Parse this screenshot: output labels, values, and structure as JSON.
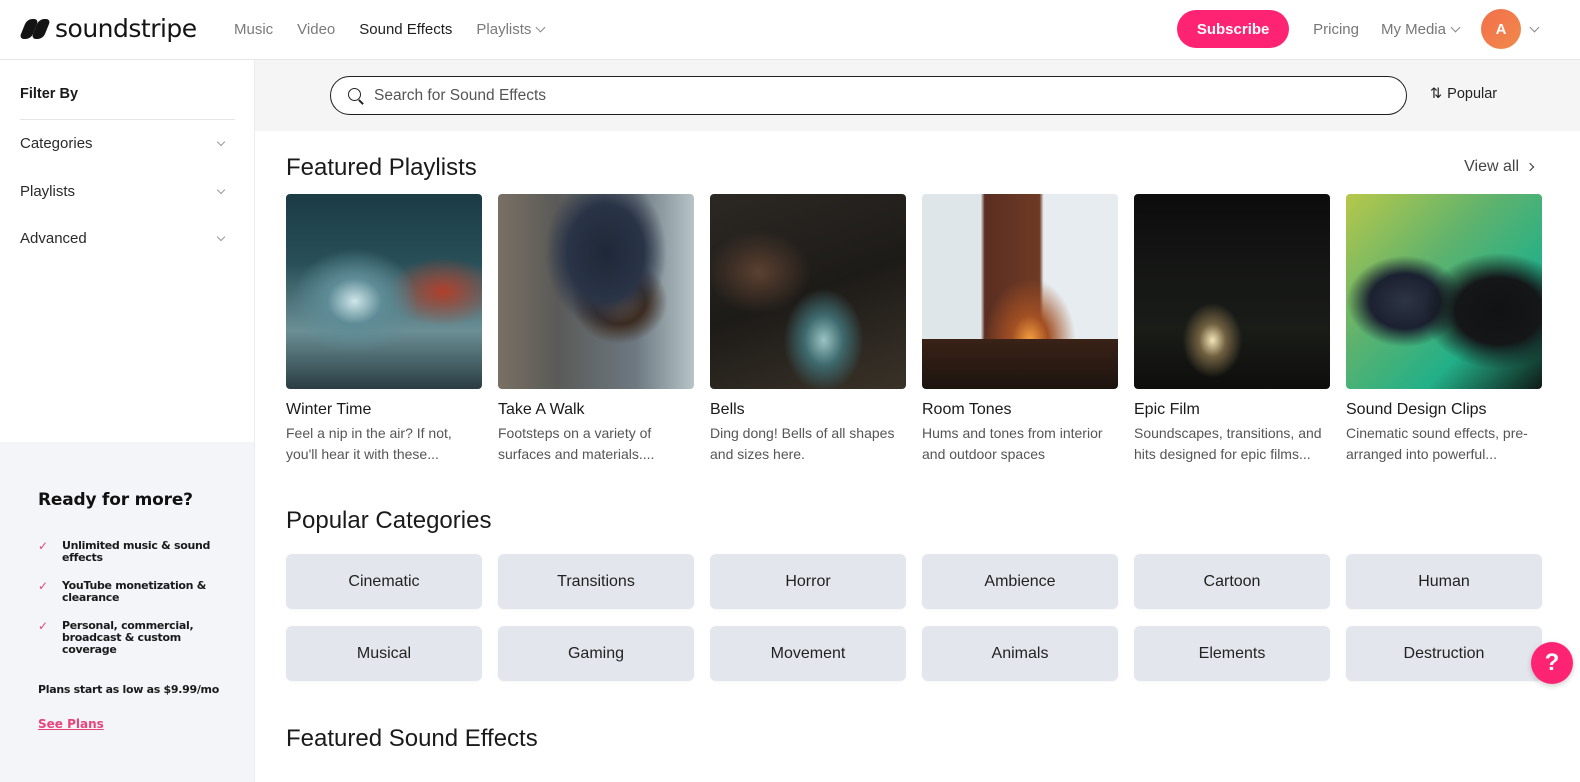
{
  "header": {
    "logo_text": "soundstripe",
    "nav": [
      {
        "label": "Music",
        "active": false
      },
      {
        "label": "Video",
        "active": false
      },
      {
        "label": "Sound Effects",
        "active": true
      },
      {
        "label": "Playlists",
        "active": false,
        "has_dropdown": true
      }
    ],
    "subscribe_label": "Subscribe",
    "pricing_label": "Pricing",
    "my_media_label": "My Media",
    "avatar_initial": "A",
    "brand_color": "#ff2473"
  },
  "sidebar": {
    "filter_title": "Filter By",
    "filters": [
      {
        "label": "Categories"
      },
      {
        "label": "Playlists"
      },
      {
        "label": "Advanced"
      }
    ],
    "promo": {
      "title": "Ready for more?",
      "items": [
        "Unlimited music & sound effects",
        "YouTube monetization & clearance",
        "Personal, commercial, broadcast & custom coverage"
      ],
      "price_text": "Plans start as low as $9.99/mo",
      "cta_label": "See Plans"
    }
  },
  "search": {
    "placeholder": "Search for Sound Effects",
    "value": "",
    "sort_label": "Popular",
    "sort_icon": "sort-arrows-icon"
  },
  "featured_playlists": {
    "title": "Featured Playlists",
    "view_all_label": "View all",
    "items": [
      {
        "name": "Winter Time",
        "description": "Feel a nip in the air? If not, you'll hear it with these..."
      },
      {
        "name": "Take A Walk",
        "description": "Footsteps on a variety of surfaces and materials...."
      },
      {
        "name": "Bells",
        "description": "Ding dong! Bells of all shapes and sizes here."
      },
      {
        "name": "Room Tones",
        "description": "Hums and tones from interior and outdoor spaces"
      },
      {
        "name": "Epic Film",
        "description": "Soundscapes, transitions, and hits designed for epic films..."
      },
      {
        "name": "Sound Design Clips",
        "description": "Cinematic sound effects, pre-arranged into powerful..."
      }
    ]
  },
  "popular_categories": {
    "title": "Popular Categories",
    "items": [
      "Cinematic",
      "Transitions",
      "Horror",
      "Ambience",
      "Cartoon",
      "Human",
      "Musical",
      "Gaming",
      "Movement",
      "Animals",
      "Elements",
      "Destruction"
    ]
  },
  "featured_sound_effects": {
    "title": "Featured Sound Effects"
  },
  "help": {
    "label": "?"
  }
}
